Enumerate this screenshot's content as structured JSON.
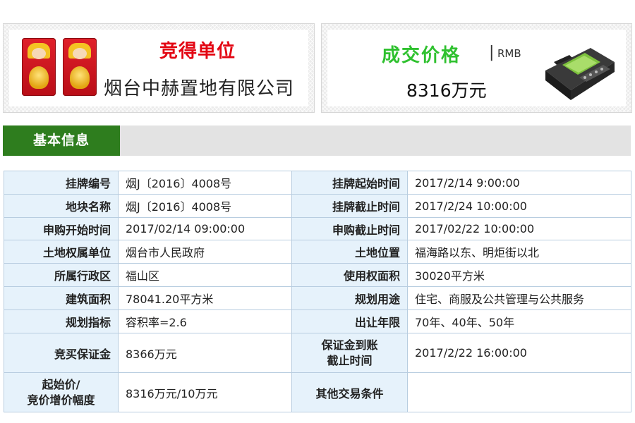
{
  "winner": {
    "title": "竞得单位",
    "company": "烟台中赫置地有限公司"
  },
  "price": {
    "title": "成交价格",
    "separator": "|",
    "currency": "RMB",
    "amount": "8316万元"
  },
  "tab": {
    "label": "基本信息"
  },
  "table": {
    "rows": [
      {
        "label1": "挂牌编号",
        "value1": "烟J〔2016〕4008号",
        "label2": "挂牌起始时间",
        "value2": "2017/2/14 9:00:00"
      },
      {
        "label1": "地块名称",
        "value1": "烟J〔2016〕4008号",
        "label2": "挂牌截止时间",
        "value2": "2017/2/24 10:00:00"
      },
      {
        "label1": "申购开始时间",
        "value1": "2017/02/14 09:00:00",
        "label2": "申购截止时间",
        "value2": "2017/02/22 10:00:00"
      },
      {
        "label1": "土地权属单位",
        "value1": "烟台市人民政府",
        "label2": "土地位置",
        "value2": "福海路以东、明炬街以北"
      },
      {
        "label1": "所属行政区",
        "value1": "福山区",
        "label2": "使用权面积",
        "value2": "30020平方米"
      },
      {
        "label1": "建筑面积",
        "value1": "78041.20平方米",
        "label2": "规划用途",
        "value2": "住宅、商服及公共管理与公共服务"
      },
      {
        "label1": "规划指标",
        "value1": "容积率=2.6",
        "label2": "出让年限",
        "value2": "70年、40年、50年"
      },
      {
        "label1": "竞买保证金",
        "value1": "8366万元",
        "label2_line1": "保证金到账",
        "label2_line2": "截止时间",
        "value2": "2017/2/22 16:00:00"
      },
      {
        "label1_line1": "起始价/",
        "label1_line2": "竞价增价幅度",
        "value1": "8316万元/10万元",
        "label2": "其他交易条件",
        "value2": ""
      }
    ]
  }
}
